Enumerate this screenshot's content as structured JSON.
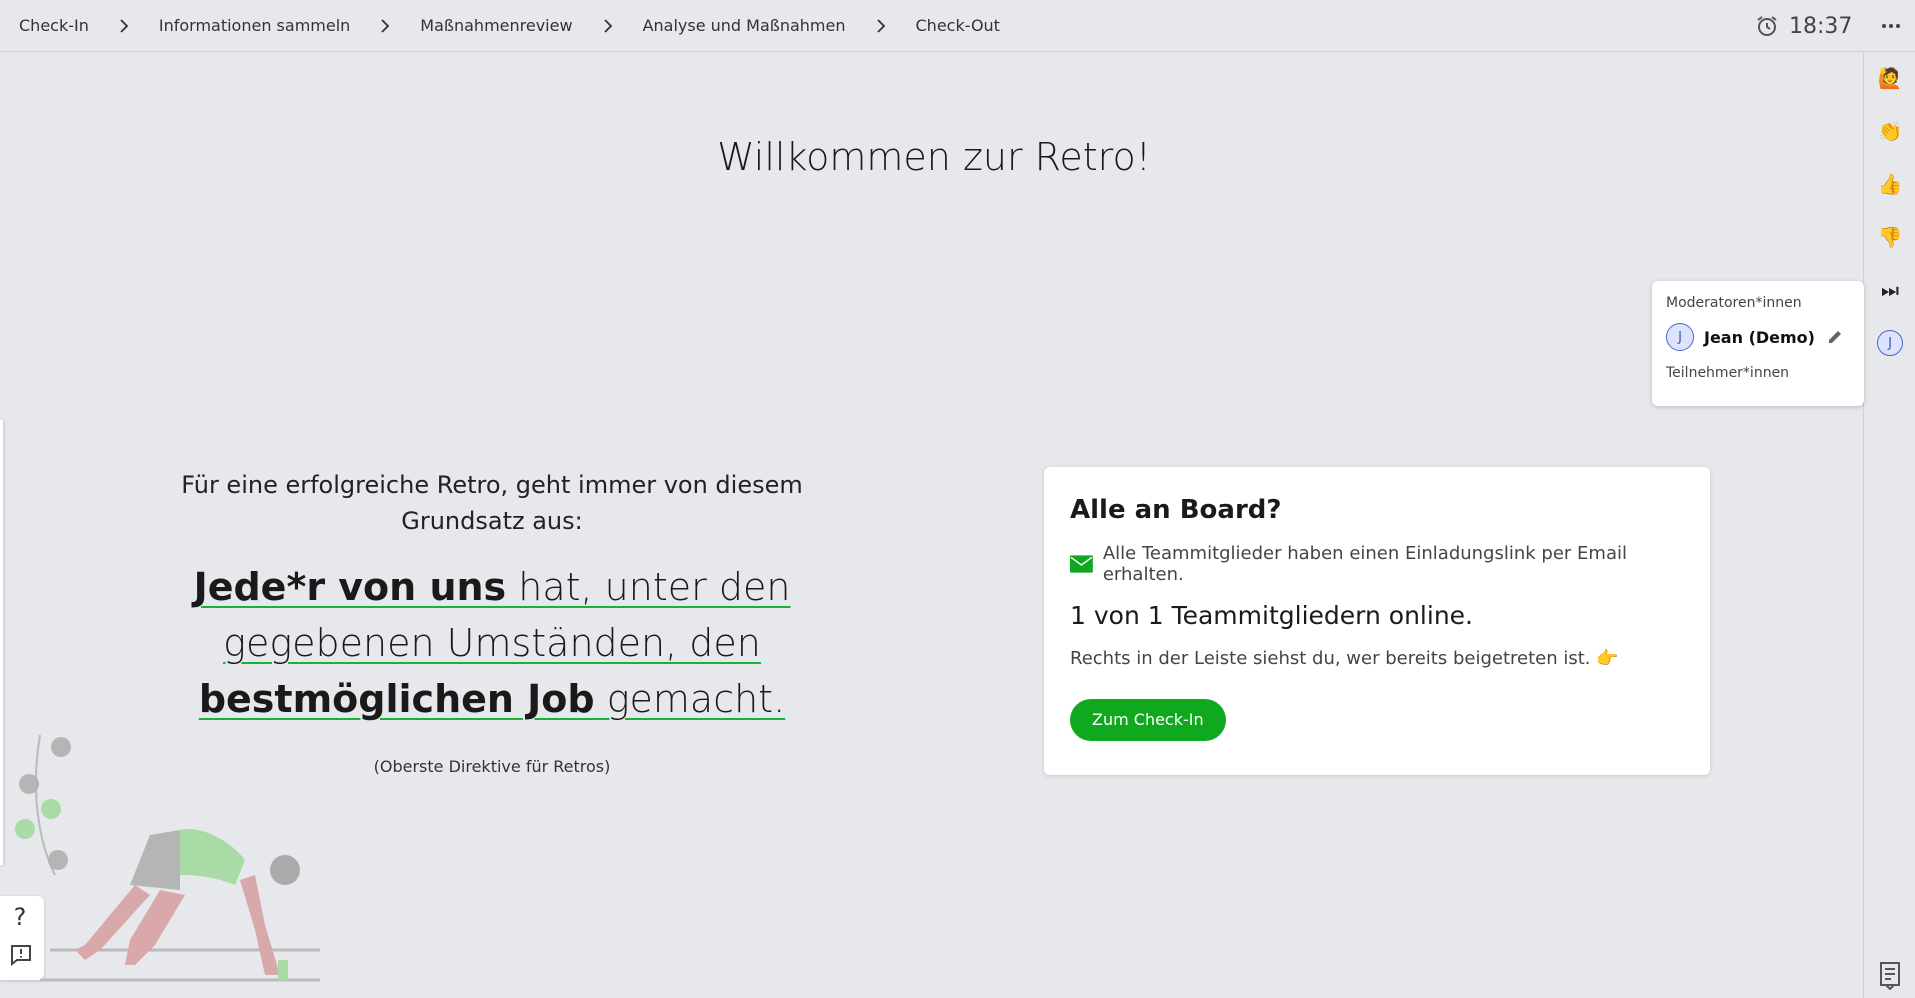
{
  "breadcrumb": {
    "steps": [
      "Check-In",
      "Informationen sammeln",
      "Maßnahmenreview",
      "Analyse und Maßnahmen",
      "Check-Out"
    ]
  },
  "timer": {
    "time": "18:37",
    "icon": "alarm-clock-icon"
  },
  "sidebar": {
    "reactions": [
      {
        "icon": "raising-hand-icon",
        "glyph": "🙋"
      },
      {
        "icon": "clapping-hands-icon",
        "glyph": "👏"
      },
      {
        "icon": "thumbs-up-icon",
        "glyph": "👍"
      },
      {
        "icon": "thumbs-down-icon",
        "glyph": "👎"
      },
      {
        "icon": "fast-forward-icon",
        "glyph": "⏭"
      }
    ],
    "user_initial": "J"
  },
  "members": {
    "moderators_label": "Moderatoren*innen",
    "moderator_initial": "J",
    "moderator_name": "Jean (Demo)",
    "participants_label": "Teilnehmer*innen"
  },
  "welcome": {
    "title": "Willkommen zur Retro!"
  },
  "directive": {
    "intro": "Für eine erfolgreiche Retro, geht immer von diesem Grundsatz aus:",
    "part1_bold": "Jede*r von uns",
    "part2": " hat, unter den gegebenen Umständen, den ",
    "part3_bold": "bestmöglichen Job",
    "part4": " gemacht.",
    "source": "(Oberste Direktive für Retros)"
  },
  "card": {
    "title": "Alle an Board?",
    "invite_text": "Alle Teammitglieder haben einen Einladungslink per Email erhalten.",
    "online_text": "1 von 1 Teammitgliedern online.",
    "hint_text": "Rechts in der Leiste siehst du, wer bereits beigetreten ist. 👉",
    "cta_label": "Zum Check-In"
  },
  "help": {
    "question_mark": "?"
  },
  "colors": {
    "accent": "#10a81f",
    "avatar": "#4a66d6",
    "background": "#e7e8ec"
  }
}
